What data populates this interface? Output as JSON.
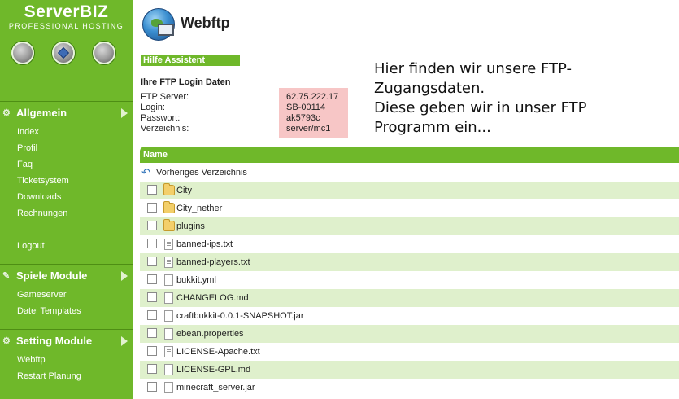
{
  "brand": {
    "name": "ServerBIZ",
    "tagline": "PROFESSIONAL HOSTING"
  },
  "sidebar": {
    "sections": [
      {
        "title": "Allgemein",
        "items": [
          "Index",
          "Profil",
          "Faq",
          "Ticketsystem",
          "Downloads",
          "Rechnungen",
          "Logout"
        ]
      },
      {
        "title": "Spiele Module",
        "items": [
          "Gameserver",
          "Datei Templates"
        ]
      },
      {
        "title": "Setting Module",
        "items": [
          "Webftp",
          "Restart Planung"
        ]
      }
    ]
  },
  "header": {
    "title": "Webftp"
  },
  "help": {
    "bar_label": "Hilfe Assistent",
    "login_title": "Ihre FTP Login Daten",
    "labels": [
      "FTP Server:",
      "Login:",
      "Passwort:",
      "Verzeichnis:"
    ],
    "values": [
      "62.75.222.17",
      "SB-00114",
      "ak5793c",
      "server/mc1"
    ]
  },
  "annotation": {
    "lines": [
      "Hier finden wir unsere FTP-",
      "Zugangsdaten.",
      "Diese geben wir in unser FTP",
      "Programm ein..."
    ]
  },
  "files": {
    "column_header": "Name",
    "prev_dir_label": "Vorheriges Verzeichnis",
    "rows": [
      {
        "name": "City",
        "type": "folder"
      },
      {
        "name": "City_nether",
        "type": "folder"
      },
      {
        "name": "plugins",
        "type": "folder"
      },
      {
        "name": "banned-ips.txt",
        "type": "text"
      },
      {
        "name": "banned-players.txt",
        "type": "text"
      },
      {
        "name": "bukkit.yml",
        "type": "file"
      },
      {
        "name": "CHANGELOG.md",
        "type": "file"
      },
      {
        "name": "craftbukkit-0.0.1-SNAPSHOT.jar",
        "type": "file"
      },
      {
        "name": "ebean.properties",
        "type": "file"
      },
      {
        "name": "LICENSE-Apache.txt",
        "type": "text"
      },
      {
        "name": "LICENSE-GPL.md",
        "type": "file"
      },
      {
        "name": "minecraft_server.jar",
        "type": "file"
      }
    ]
  },
  "colors": {
    "accent_green": "#6fb82a",
    "row_alt": "#dff0cc",
    "highlight_pink": "#f7c6c6"
  }
}
